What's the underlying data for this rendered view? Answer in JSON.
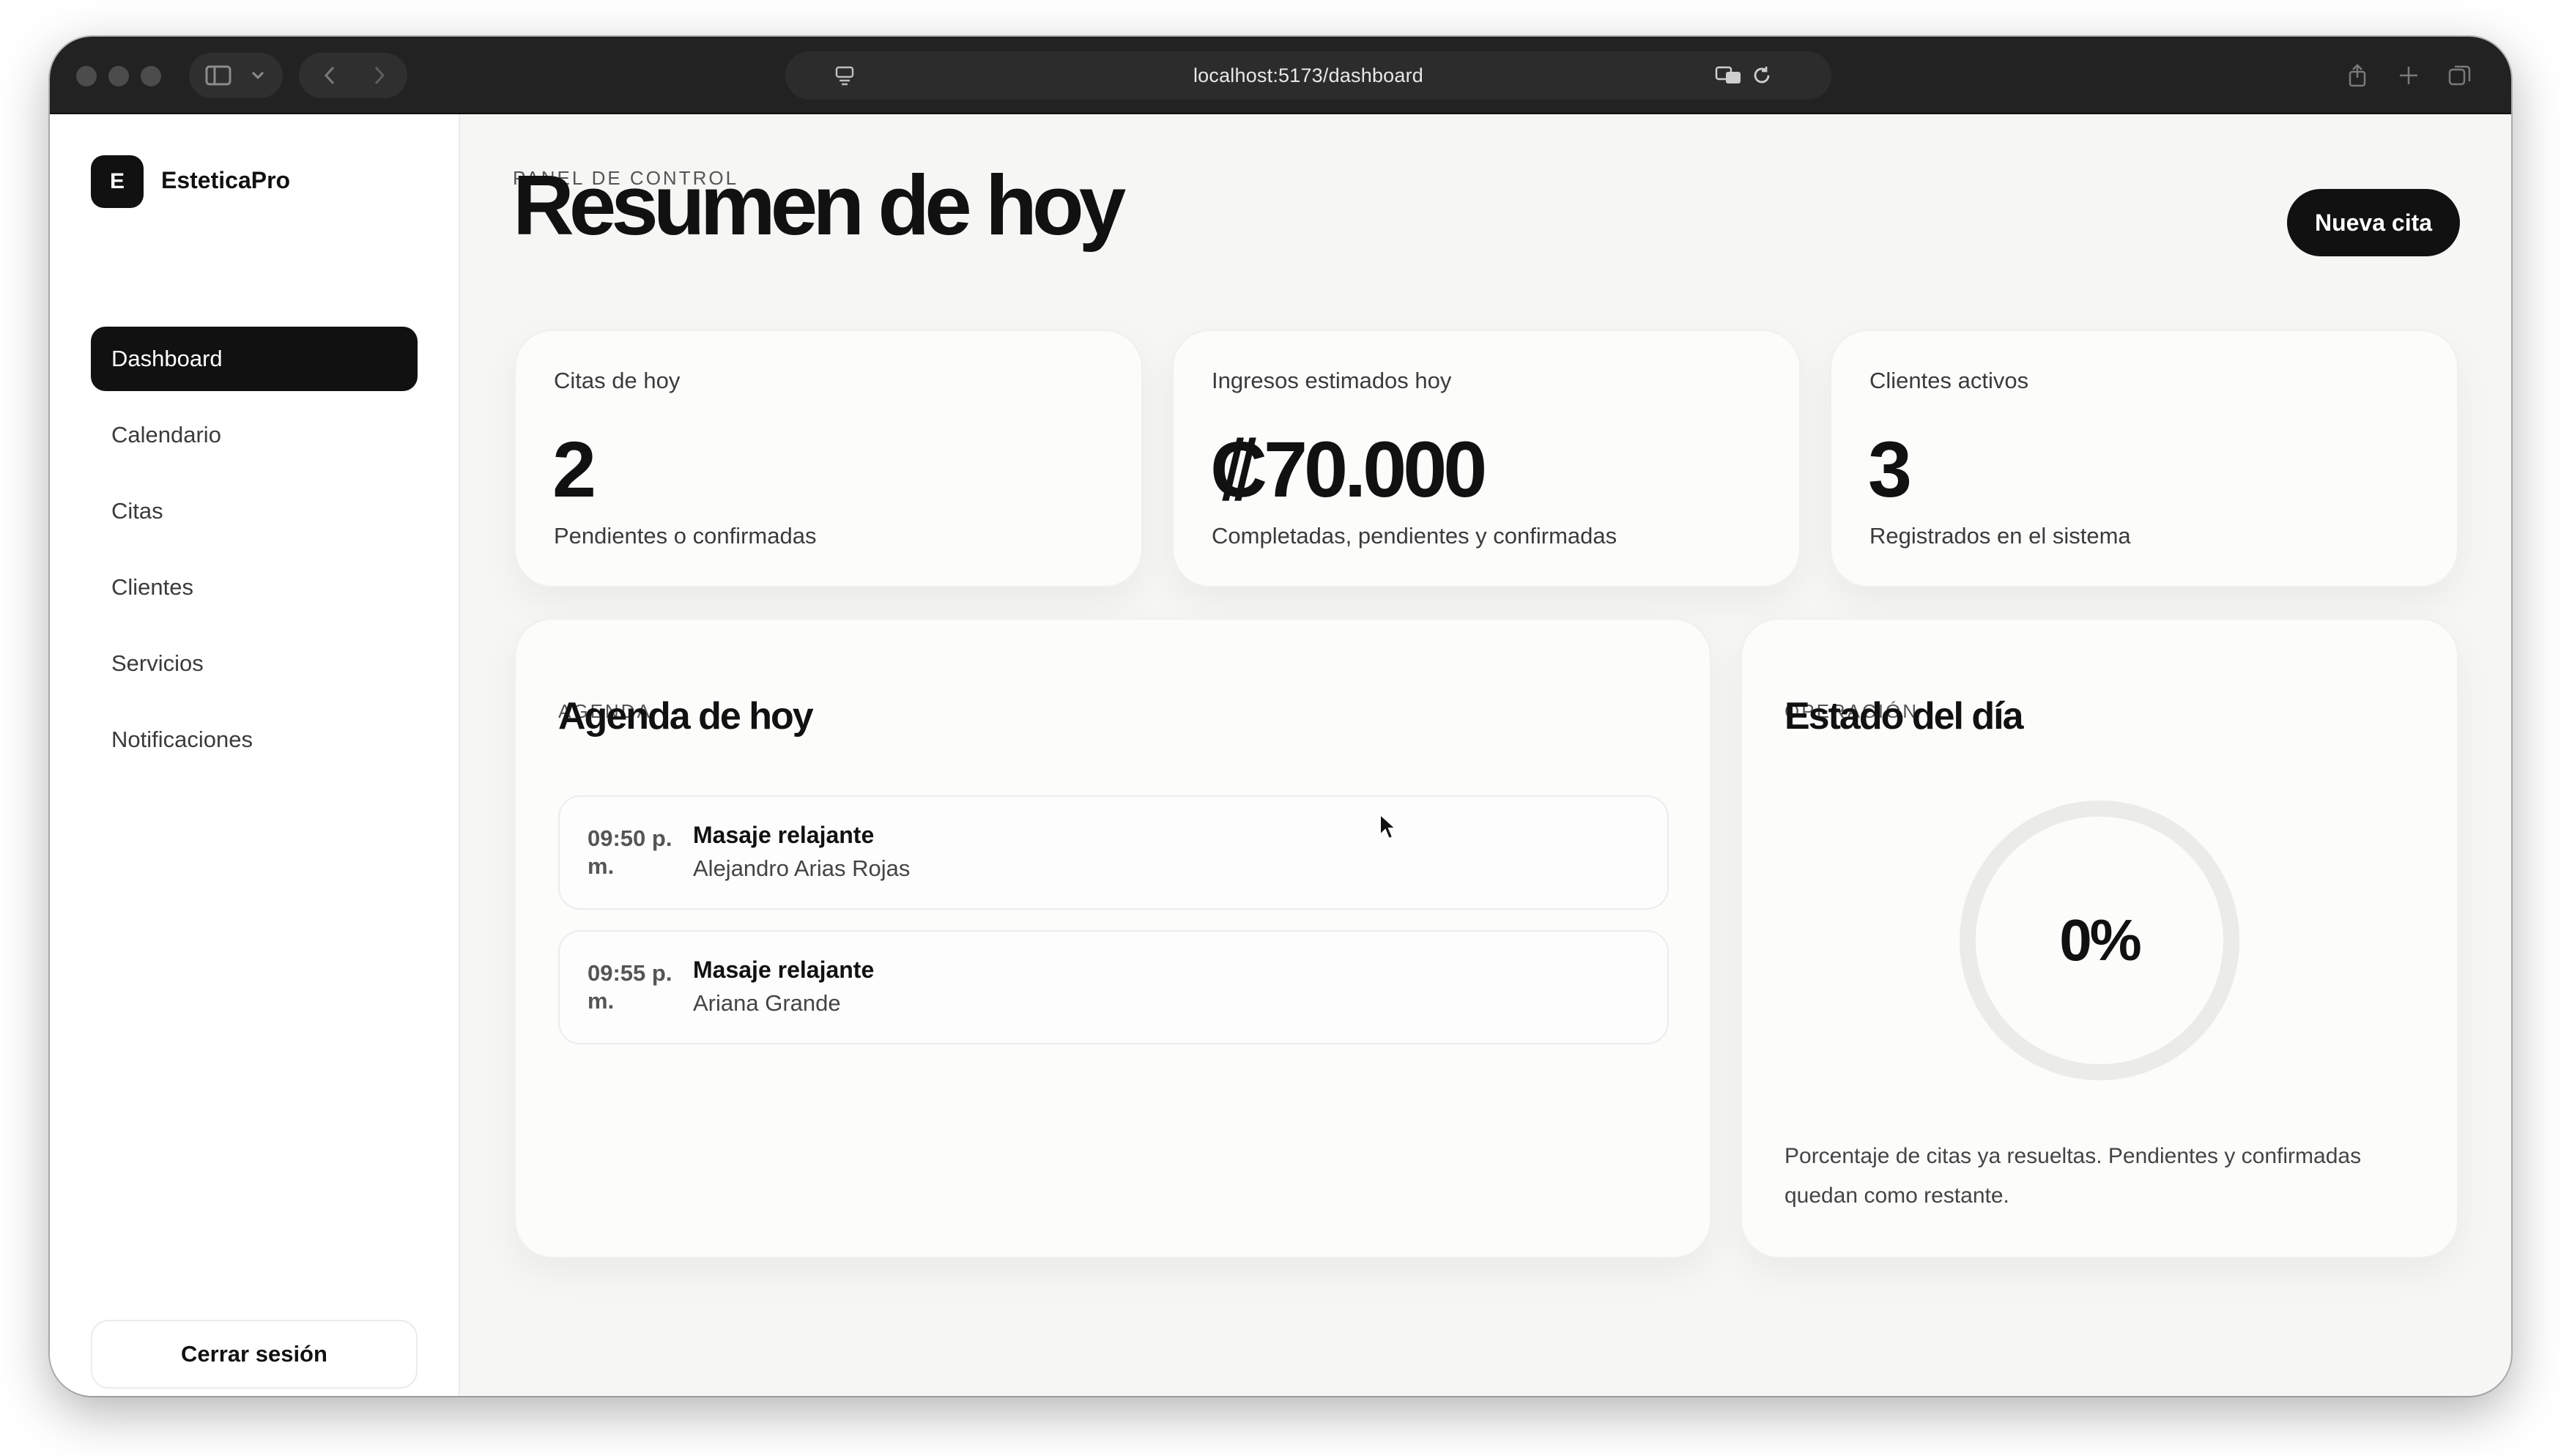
{
  "browser": {
    "url": "localhost:5173/dashboard"
  },
  "sidebar": {
    "logo_letter": "E",
    "brand": "EsteticaPro",
    "items": [
      {
        "label": "Dashboard",
        "active": true
      },
      {
        "label": "Calendario",
        "active": false
      },
      {
        "label": "Citas",
        "active": false
      },
      {
        "label": "Clientes",
        "active": false
      },
      {
        "label": "Servicios",
        "active": false
      },
      {
        "label": "Notificaciones",
        "active": false
      }
    ],
    "logout_label": "Cerrar sesión"
  },
  "header": {
    "eyebrow": "PANEL DE CONTROL",
    "title": "Resumen de hoy",
    "new_appointment_label": "Nueva cita"
  },
  "stats": [
    {
      "label": "Citas de hoy",
      "value": "2",
      "sub": "Pendientes o confirmadas"
    },
    {
      "label": "Ingresos estimados hoy",
      "value": "₡70.000",
      "sub": "Completadas, pendientes y confirmadas"
    },
    {
      "label": "Clientes activos",
      "value": "3",
      "sub": "Registrados en el sistema"
    }
  ],
  "agenda": {
    "eyebrow": "AGENDA",
    "title": "Agenda de hoy",
    "appointments": [
      {
        "time": "09:50 p. m.",
        "service": "Masaje relajante",
        "client": "Alejandro Arias Rojas"
      },
      {
        "time": "09:55 p. m.",
        "service": "Masaje relajante",
        "client": "Ariana Grande"
      }
    ]
  },
  "status": {
    "eyebrow": "OPERACIÓN",
    "title": "Estado del día",
    "progress_label": "0%",
    "progress_value": 0,
    "description": "Porcentaje de citas ya resueltas. Pendientes y confirmadas quedan como restante."
  },
  "colors": {
    "accent": "#111111",
    "background": "#f6f6f5",
    "card": "#fcfcfb",
    "ring_track": "#ebebea"
  }
}
